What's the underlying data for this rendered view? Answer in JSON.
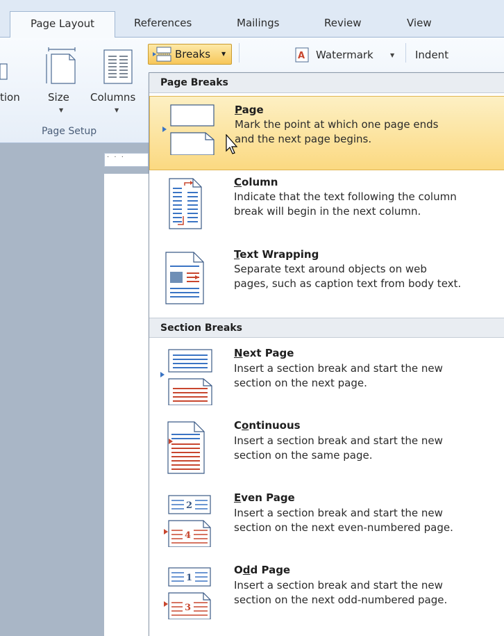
{
  "ribbon": {
    "tabs": [
      "Page Layout",
      "References",
      "Mailings",
      "Review",
      "View"
    ],
    "partial_label": "tion",
    "size_label": "Size",
    "columns_label": "Columns",
    "group_title": "Page Setup",
    "breaks_label": "Breaks",
    "watermark_label": "Watermark",
    "indent_label": "Indent"
  },
  "ruler": {
    "marks": "· · ·"
  },
  "menu": {
    "page_breaks_header": "Page Breaks",
    "section_breaks_header": "Section Breaks",
    "items": [
      {
        "title_accel": "P",
        "title_rest": "age",
        "desc1": "Mark the point at which one page ends",
        "desc2": "and the next page begins.",
        "icon": "page-break-icon"
      },
      {
        "title_accel": "C",
        "title_rest": "olumn",
        "desc1": "Indicate that the text following the column",
        "desc2": "break will begin in the next column.",
        "icon": "column-break-icon"
      },
      {
        "title_accel": "T",
        "title_rest": "ext Wrapping",
        "desc1": "Separate text around objects on web",
        "desc2": "pages, such as caption text from body text.",
        "icon": "text-wrapping-icon"
      },
      {
        "title_accel": "N",
        "title_rest": "ext Page",
        "desc1": "Insert a section break and start the new",
        "desc2": "section on the next page.",
        "icon": "next-page-section-icon"
      },
      {
        "title_pre": "C",
        "title_accel": "o",
        "title_rest": "ntinuous",
        "desc1": "Insert a section break and start the new",
        "desc2": "section on the same page.",
        "icon": "continuous-section-icon"
      },
      {
        "title_accel": "E",
        "title_rest": "ven Page",
        "desc1": "Insert a section break and start the new",
        "desc2": "section on the next even-numbered page.",
        "icon": "even-page-section-icon",
        "num_top": "2",
        "num_bottom": "4"
      },
      {
        "title_pre": "O",
        "title_accel": "d",
        "title_rest": "d Page",
        "desc1": "Insert a section break and start the new",
        "desc2": "section on the next odd-numbered page.",
        "icon": "odd-page-section-icon",
        "num_top": "1",
        "num_bottom": "3"
      }
    ]
  },
  "colors": {
    "highlight": "#fbd981",
    "accent_red": "#c8462e",
    "accent_blue": "#3a74c4"
  }
}
